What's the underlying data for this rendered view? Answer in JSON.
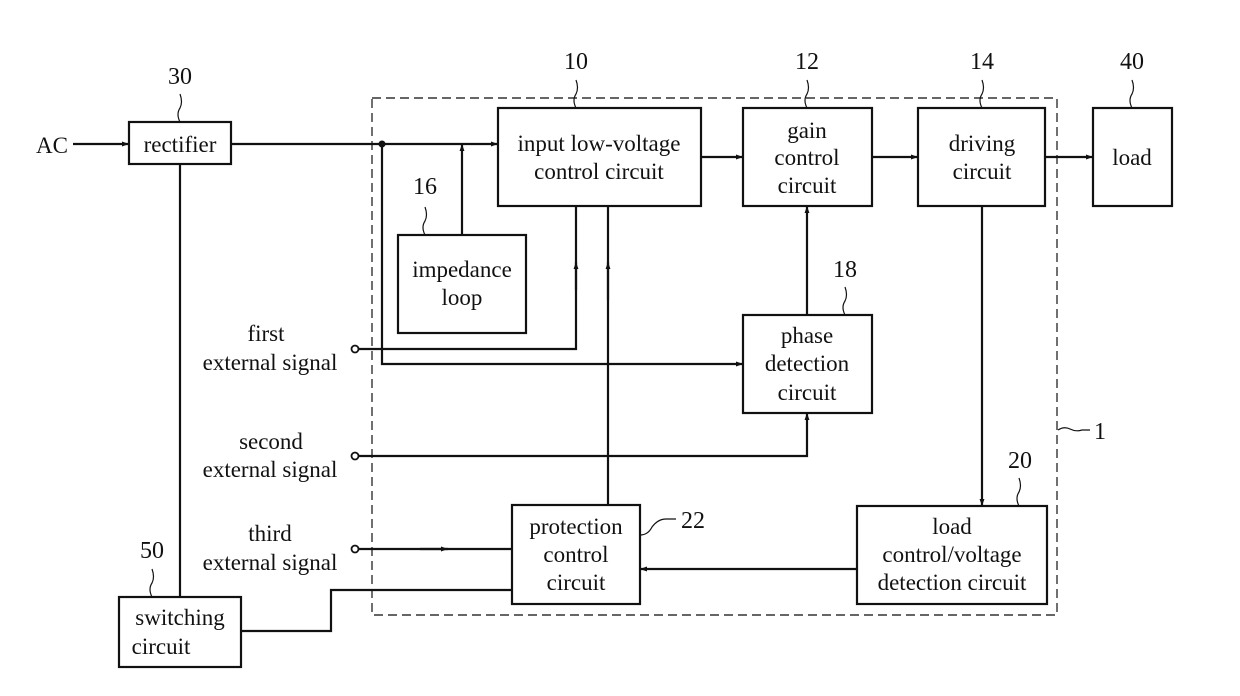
{
  "diagram": {
    "system_ref": "1",
    "input_source": "AC",
    "blocks": {
      "rectifier": {
        "ref": "30",
        "lines": [
          "rectifier"
        ]
      },
      "input_low_voltage": {
        "ref": "10",
        "lines": [
          "input low-voltage",
          "control circuit"
        ]
      },
      "gain_control": {
        "ref": "12",
        "lines": [
          "gain",
          "control",
          "circuit"
        ]
      },
      "driving": {
        "ref": "14",
        "lines": [
          "driving",
          "circuit"
        ]
      },
      "load": {
        "ref": "40",
        "lines": [
          "load"
        ]
      },
      "impedance_loop": {
        "ref": "16",
        "lines": [
          "impedance",
          "loop"
        ]
      },
      "phase_detection": {
        "ref": "18",
        "lines": [
          "phase",
          "detection",
          "circuit"
        ]
      },
      "load_control": {
        "ref": "20",
        "lines": [
          "load",
          "control/voltage",
          "detection circuit"
        ]
      },
      "protection_control": {
        "ref": "22",
        "lines": [
          "protection",
          "control",
          "circuit"
        ]
      },
      "switching": {
        "ref": "50",
        "lines": [
          "switching",
          "circuit"
        ]
      }
    },
    "signals": {
      "first": [
        "first",
        "external signal"
      ],
      "second": [
        "second",
        "external signal"
      ],
      "third": [
        "third",
        "external signal"
      ]
    }
  }
}
